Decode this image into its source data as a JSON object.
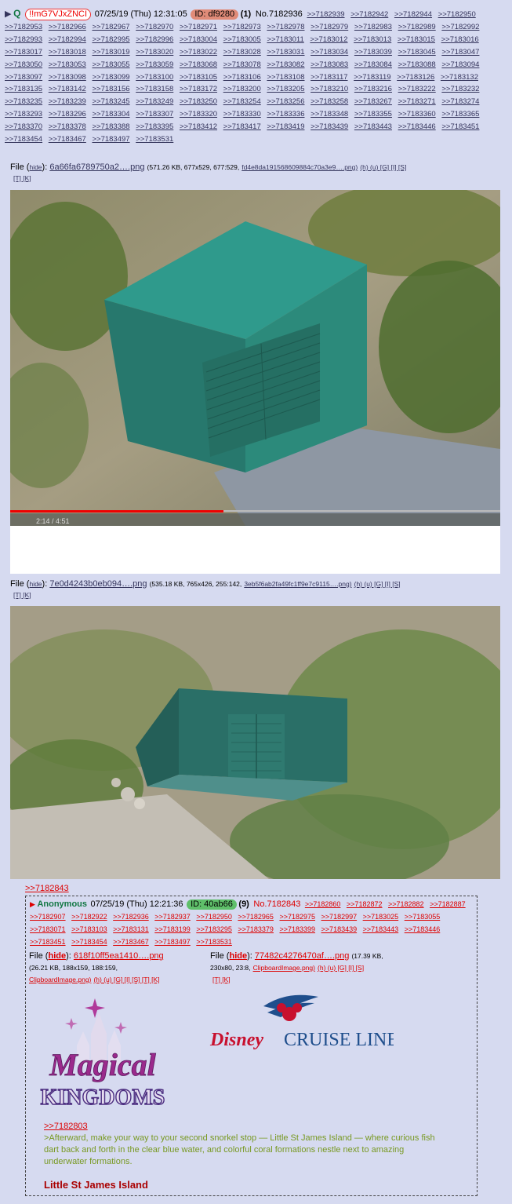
{
  "post": {
    "prefix": "Q",
    "tripcode": "!!mG7VJxZNCI",
    "date": "07/25/19 (Thu) 12:31:05",
    "id_label": "ID: df9280",
    "reply_count": "(1)",
    "number": "No.7182936",
    "backlinks": [
      ">>7182939",
      ">>7182942",
      ">>7182944",
      ">>7182950",
      ">>7182953",
      ">>7182966",
      ">>7182967",
      ">>7182970",
      ">>7182971",
      ">>7182973",
      ">>7182978",
      ">>7182979",
      ">>7182983",
      ">>7182989",
      ">>7182992",
      ">>7182993",
      ">>7182994",
      ">>7182995",
      ">>7182996",
      ">>7183004",
      ">>7183005",
      ">>7183011",
      ">>7183012",
      ">>7183013",
      ">>7183015",
      ">>7183016",
      ">>7183017",
      ">>7183018",
      ">>7183019",
      ">>7183020",
      ">>7183022",
      ">>7183028",
      ">>7183031",
      ">>7183034",
      ">>7183039",
      ">>7183045",
      ">>7183047",
      ">>7183050",
      ">>7183053",
      ">>7183055",
      ">>7183059",
      ">>7183068",
      ">>7183078",
      ">>7183082",
      ">>7183083",
      ">>7183084",
      ">>7183088",
      ">>7183094",
      ">>7183097",
      ">>7183098",
      ">>7183099",
      ">>7183100",
      ">>7183105",
      ">>7183106",
      ">>7183108",
      ">>7183117",
      ">>7183119",
      ">>7183126",
      ">>7183132",
      ">>7183135",
      ">>7183142",
      ">>7183156",
      ">>7183158",
      ">>7183172",
      ">>7183200",
      ">>7183205",
      ">>7183210",
      ">>7183216",
      ">>7183222",
      ">>7183232",
      ">>7183235",
      ">>7183239",
      ">>7183245",
      ">>7183249",
      ">>7183250",
      ">>7183254",
      ">>7183256",
      ">>7183258",
      ">>7183267",
      ">>7183271",
      ">>7183274",
      ">>7183293",
      ">>7183296",
      ">>7183304",
      ">>7183307",
      ">>7183320",
      ">>7183330",
      ">>7183336",
      ">>7183348",
      ">>7183355",
      ">>7183360",
      ">>7183365",
      ">>7183370",
      ">>7183378",
      ">>7183388",
      ">>7183395",
      ">>7183412",
      ">>7183417",
      ">>7183419",
      ">>7183439",
      ">>7183443",
      ">>7183446",
      ">>7183451",
      ">>7183454",
      ">>7183467",
      ">>7183497",
      ">>7183531"
    ],
    "file1": {
      "label": "File",
      "hide": "hide",
      "name": "6a66fa6789750a2….png",
      "meta": "(571.26 KB, 677x529, 677:529,",
      "orig": "fd4e8da191568609884c70a3e9….png)",
      "tools": "(h) (u) [G] [I] [S]",
      "tools2": "[T] [K]",
      "video_time": "2:14 / 4:51"
    },
    "file2": {
      "label": "File",
      "hide": "hide",
      "name": "7e0d4243b0eb094….png",
      "meta": "(535.18 KB, 765x426, 255:142,",
      "orig": "3eb5f6ab2fa49fc1ff9e7c9115….png)",
      "tools": "(h) (u) [G] [I] [S]",
      "tools2": "[T] [K]"
    }
  },
  "reply": {
    "quoted_link": ">>7182843",
    "name": "Anonymous",
    "date": "07/25/19 (Thu) 12:21:36",
    "id_label": "ID: 40ab66",
    "reply_count": "(9)",
    "number": "No.7182843",
    "backlinks": [
      ">>7182860",
      ">>7182872",
      ">>7182882",
      ">>7182887",
      ">>7182907",
      ">>7182922",
      ">>7182936",
      ">>7182937",
      ">>7182950",
      ">>7182965",
      ">>7182975",
      ">>7182997",
      ">>7183025",
      ">>7183055",
      ">>7183071",
      ">>7183103",
      ">>7183131",
      ">>7183199",
      ">>7183295",
      ">>7183379",
      ">>7183399",
      ">>7183439",
      ">>7183443",
      ">>7183446",
      ">>7183451",
      ">>7183454",
      ">>7183467",
      ">>7183497",
      ">>7183531"
    ],
    "fileA": {
      "label": "File",
      "hide": "hide",
      "name": "618f10ff5ea1410….png",
      "meta": "(26.21 KB, 188x159, 188:159,",
      "orig": "ClipboardImage.png)",
      "tools": "(h) (u) [G] [I] [S] [T] [K]",
      "logo_line1": "Magical",
      "logo_line2": "KINGDOMS"
    },
    "fileB": {
      "label": "File",
      "hide": "hide",
      "name": "77482c4276470af….png",
      "meta": "(17.39 KB,",
      "meta2": "230x80, 23:8,",
      "orig": "ClipboardImage.png)",
      "tools": "(h) (u) [G] [I] [S]",
      "tools2": "[T] [K]",
      "logo_word1": "Disney",
      "logo_word2": "CRUISE LINE"
    },
    "quote_link": ">>7182803",
    "quote_text": ">Afterward, make your way to your second snorkel stop — Little St James Island — where curious fish dart back and forth in the clear blue water, and colorful coral formations nestle next to amazing underwater formations.",
    "bold_text": "Little St James Island"
  }
}
